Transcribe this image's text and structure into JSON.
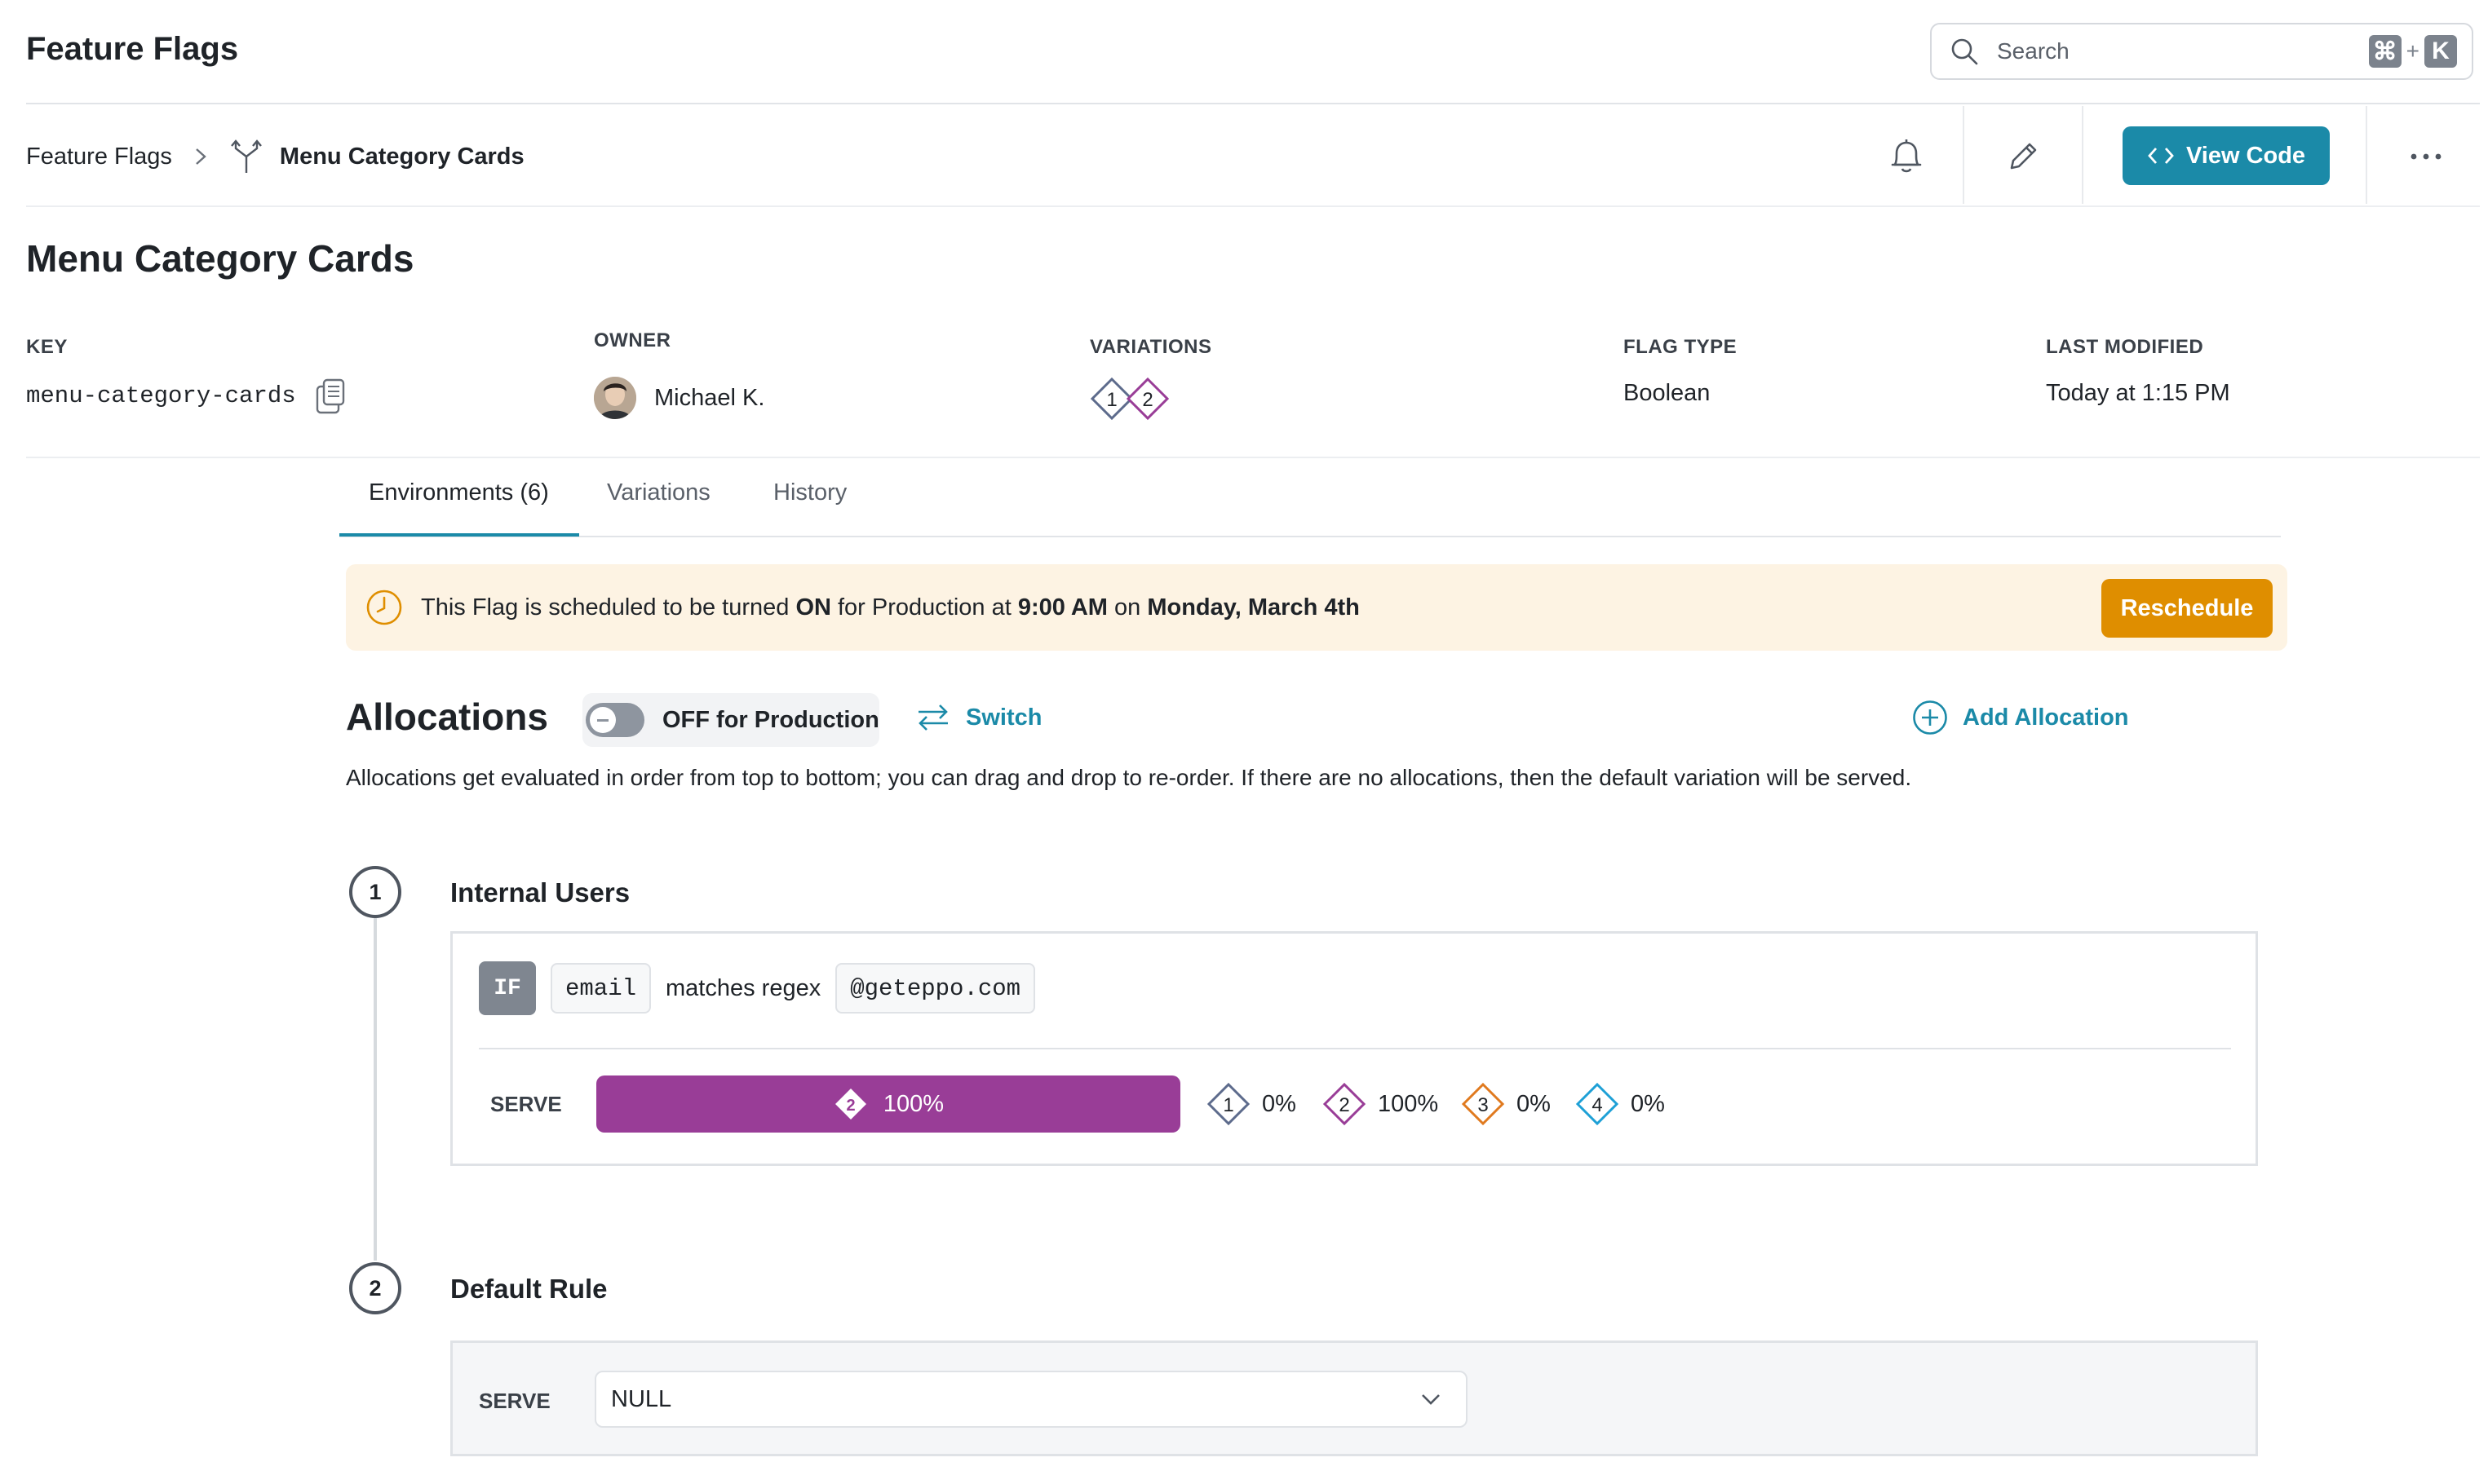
{
  "app": {
    "title": "Feature Flags"
  },
  "search": {
    "placeholder": "Search",
    "shortcut_cmd": "⌘",
    "shortcut_plus": "+",
    "shortcut_key": "K"
  },
  "breadcrumb": {
    "parent": "Feature Flags",
    "current": "Menu Category Cards"
  },
  "toolbar": {
    "view_code_label": "View Code",
    "view_code_color": "#1b8aa8"
  },
  "flag": {
    "title": "Menu Category Cards",
    "meta": {
      "key_label": "KEY",
      "key_value": "menu-category-cards",
      "owner_label": "OWNER",
      "owner_value": "Michael K.",
      "variations_label": "VARIATIONS",
      "variation_badges": [
        "1",
        "2"
      ],
      "flag_type_label": "FLAG TYPE",
      "flag_type_value": "Boolean",
      "last_modified_label": "LAST MODIFIED",
      "last_modified_value": "Today at 1:15 PM"
    }
  },
  "tabs": [
    {
      "label": "Environments (6)",
      "active": true
    },
    {
      "label": "Variations",
      "active": false
    },
    {
      "label": "History",
      "active": false
    }
  ],
  "banner": {
    "text_1": "This Flag is scheduled to be turned ",
    "text_on": "ON",
    "text_2": " for Production at ",
    "time": "9:00 AM",
    "text_3": " on ",
    "date": "Monday, March 4th",
    "button_label": "Reschedule",
    "button_color": "#df8e00",
    "background": "#fdf3e3"
  },
  "allocations": {
    "title": "Allocations",
    "status_label": "OFF for Production",
    "switch_label": "Switch",
    "add_label": "Add Allocation",
    "description": "Allocations get evaluated in order from top to bottom; you can drag and drop to re-order. If there are no allocations, then the default variation will be served.",
    "items": [
      {
        "step": "1",
        "title": "Internal Users",
        "condition": {
          "if_label": "IF",
          "attribute": "email",
          "operator": "matches regex",
          "value": "@geteppo.com"
        },
        "serve_label": "SERVE",
        "bar": {
          "variation": "2",
          "percent": "100%",
          "color": "#993d97"
        },
        "split": [
          {
            "variation": "1",
            "percent": "0%",
            "color": "#5d6b8c"
          },
          {
            "variation": "2",
            "percent": "100%",
            "color": "#993d97"
          },
          {
            "variation": "3",
            "percent": "0%",
            "color": "#e07a1f"
          },
          {
            "variation": "4",
            "percent": "0%",
            "color": "#1ea0d6"
          }
        ]
      }
    ],
    "default_rule": {
      "step": "2",
      "title": "Default Rule",
      "serve_label": "SERVE",
      "selected": "NULL"
    }
  }
}
